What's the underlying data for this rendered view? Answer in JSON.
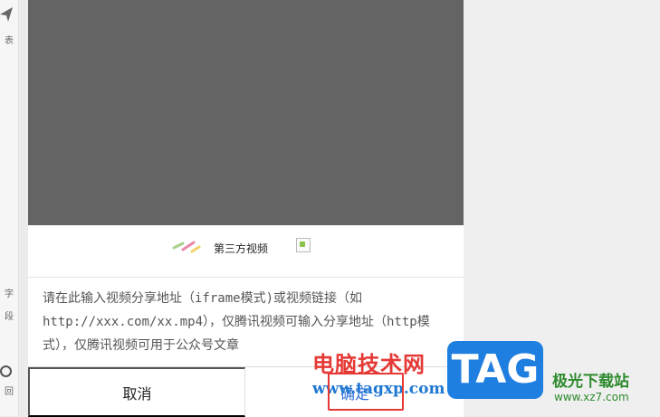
{
  "toolbar": {
    "items": [
      {
        "label": "表"
      },
      {
        "label": "字"
      },
      {
        "label": "段"
      },
      {
        "label": "回"
      }
    ]
  },
  "dialog": {
    "tab_label": "第三方视频",
    "hint": "请在此输入视频分享地址（iframe模式)或视频链接（如http://xxx.com/xx.mp4），仅腾讯视频可输入分享地址（http模式），仅腾讯视频可用于公众号文章",
    "cancel_label": "取消",
    "confirm_label": "确定"
  },
  "watermarks": {
    "site_name": "电脑技术网",
    "site_url": "www.tagxp.com",
    "logo_text": "TAG",
    "second_site_name": "极光下载站",
    "second_site_url": "www.xz7.com"
  },
  "colors": {
    "preview_bg": "#646464",
    "confirm_text": "#2f6fd8",
    "highlight_border": "#e53935",
    "logo_bg": "#1f7fe0"
  }
}
